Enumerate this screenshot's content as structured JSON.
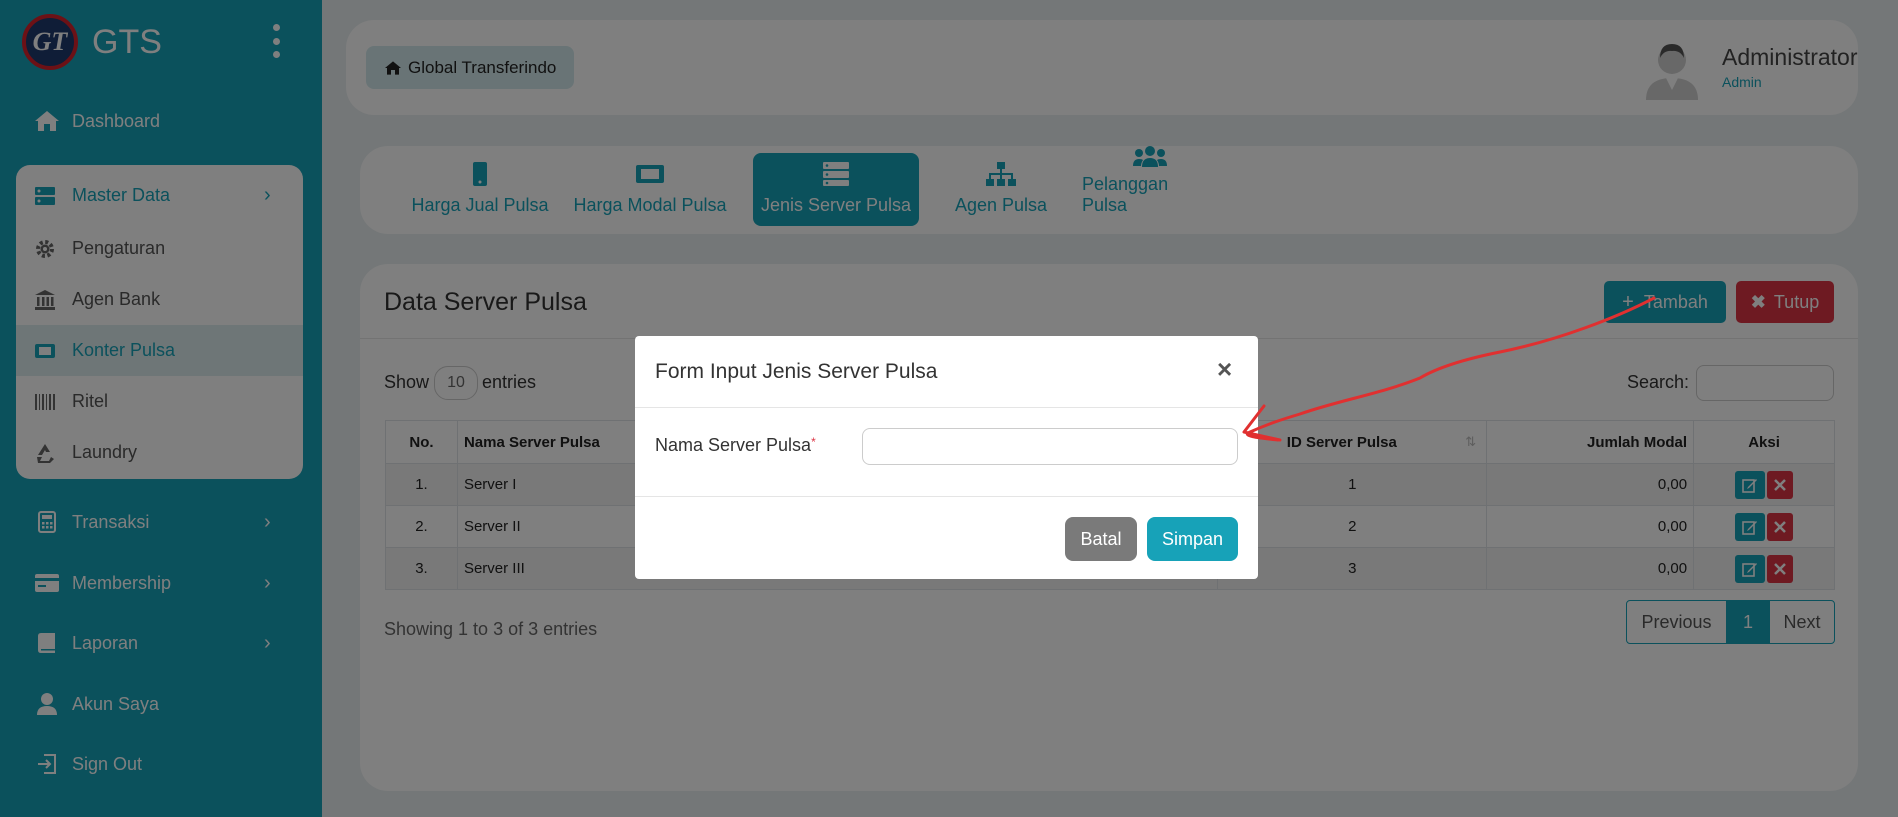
{
  "app": {
    "title": "GTS",
    "logo_text": "GT"
  },
  "sidebar": {
    "dashboard": "Dashboard",
    "master_data": {
      "label": "Master Data",
      "items": [
        {
          "label": "Pengaturan"
        },
        {
          "label": "Agen Bank"
        },
        {
          "label": "Konter Pulsa"
        },
        {
          "label": "Ritel"
        },
        {
          "label": "Laundry"
        }
      ]
    },
    "transaksi": "Transaksi",
    "membership": "Membership",
    "laporan": "Laporan",
    "akun_saya": "Akun Saya",
    "sign_out": "Sign Out"
  },
  "header": {
    "breadcrumb": "Global Transferindo",
    "user_name": "Administrator",
    "user_role": "Admin"
  },
  "tabs": [
    {
      "label": "Harga Jual Pulsa"
    },
    {
      "label": "Harga Modal Pulsa"
    },
    {
      "label": "Jenis Server Pulsa"
    },
    {
      "label": "Agen Pulsa"
    },
    {
      "label": "Pelanggan Pulsa"
    }
  ],
  "card": {
    "title": "Data Server Pulsa",
    "add_label": "Tambah",
    "close_label": "Tutup",
    "show_label": "Show",
    "page_size": "10",
    "entries_label": "entries",
    "search_label": "Search:",
    "columns": [
      "No.",
      "Nama Server Pulsa",
      "ID Server Pulsa",
      "Jumlah Modal",
      "Aksi"
    ],
    "rows": [
      {
        "no": "1.",
        "name": "Server I",
        "id": "1",
        "modal": "0,00"
      },
      {
        "no": "2.",
        "name": "Server II",
        "id": "2",
        "modal": "0,00"
      },
      {
        "no": "3.",
        "name": "Server III",
        "id": "3",
        "modal": "0,00"
      }
    ],
    "info": "Showing 1 to 3 of 3 entries",
    "pagination": {
      "previous": "Previous",
      "current": "1",
      "next": "Next"
    }
  },
  "modal": {
    "title": "Form Input Jenis Server Pulsa",
    "close_symbol": "×",
    "field_label": "Nama Server Pulsa",
    "required_mark": "*",
    "field_value": "",
    "cancel_label": "Batal",
    "save_label": "Simpan"
  },
  "colors": {
    "primary": "#17a2b8",
    "danger": "#dc3545",
    "secondary": "#7a7a7a",
    "annotation": "#e03030"
  }
}
